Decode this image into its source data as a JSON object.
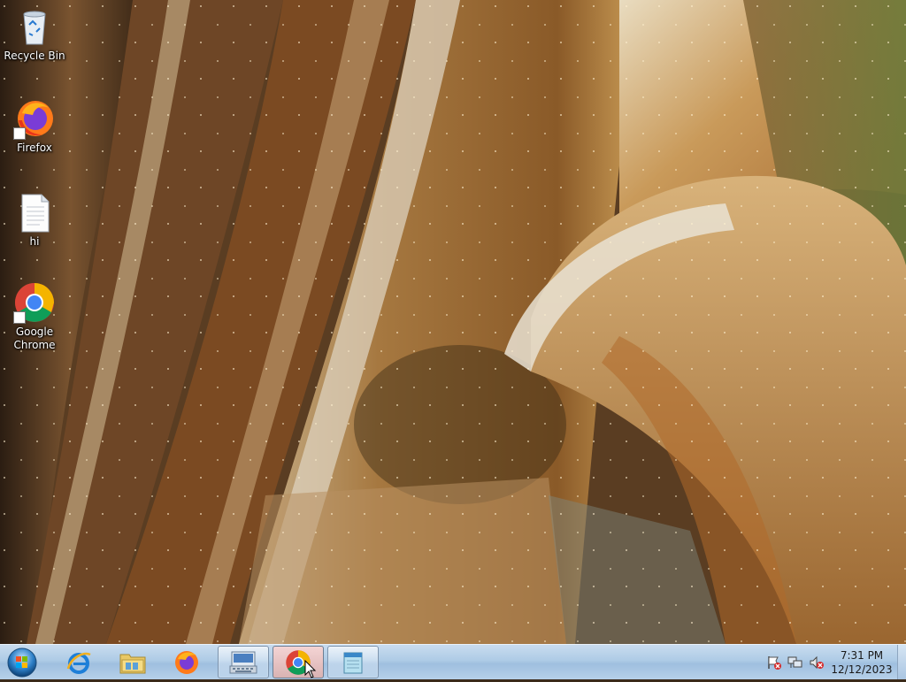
{
  "desktop": {
    "icons": [
      {
        "label": "Recycle Bin",
        "icon": "recycle-bin-icon"
      },
      {
        "label": "Firefox",
        "icon": "firefox-icon"
      },
      {
        "label": "hi",
        "icon": "text-file-icon"
      },
      {
        "label": "Google Chrome",
        "icon": "chrome-icon"
      }
    ]
  },
  "taskbar": {
    "start": {
      "icon": "windows-start-orb-icon"
    },
    "pinned": [
      {
        "icon": "internet-explorer-icon",
        "state": "pinned"
      },
      {
        "icon": "windows-explorer-icon",
        "state": "pinned"
      },
      {
        "icon": "firefox-icon",
        "state": "pinned"
      },
      {
        "icon": "on-screen-keyboard-icon",
        "state": "open"
      },
      {
        "icon": "chrome-icon",
        "state": "active"
      },
      {
        "icon": "notepad-icon",
        "state": "open"
      }
    ],
    "tray": {
      "icons": [
        "action-center-flag-icon",
        "network-icon",
        "volume-muted-icon"
      ],
      "time": "7:31 PM",
      "date": "12/12/2023"
    }
  },
  "colors": {
    "taskbar_top": "#c9dcef",
    "taskbar_bottom": "#9fbfdf",
    "active_button": "#e7c3c3"
  }
}
